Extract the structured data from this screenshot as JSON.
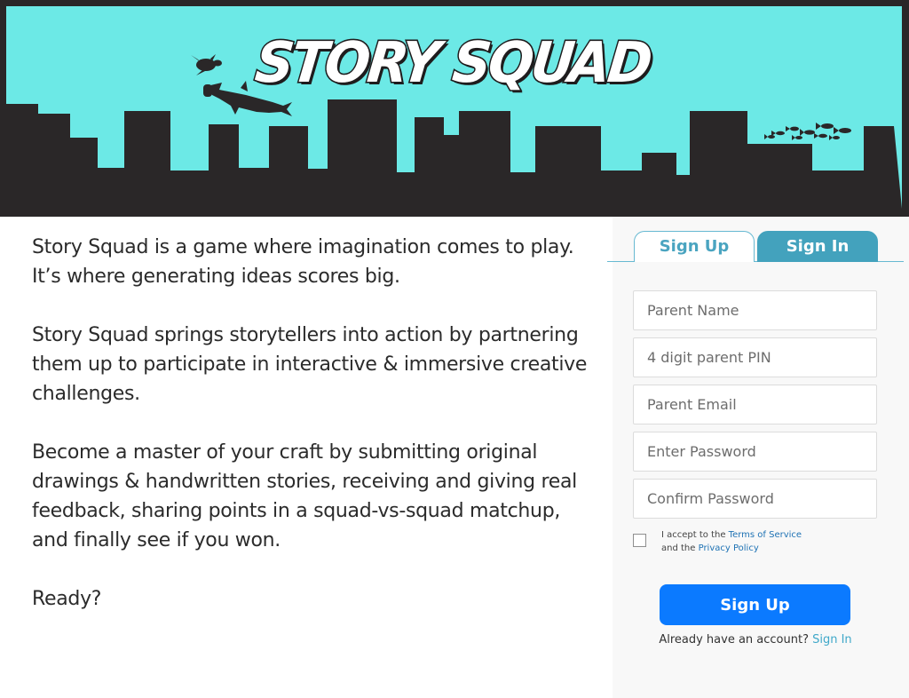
{
  "header": {
    "logo_text": "STORY SQUAD",
    "sky_color": "#6ce9e6",
    "silhouette_color": "#2a2728",
    "decorations": [
      "sea-turtle-icon",
      "hammerhead-shark-icon",
      "fish-school-icon",
      "city-skyline"
    ]
  },
  "intro": {
    "paragraphs": [
      "Story Squad is a game where imagination comes to play. It’s where generating ideas scores big.",
      "Story Squad springs storytellers into action by partnering them up to participate in interactive & immersive creative challenges.",
      "Become a master of your craft by submitting original drawings & handwritten stories, receiving and giving real feedback, sharing points in a squad-vs-squad matchup, and finally see if you won.",
      "Ready?"
    ]
  },
  "auth": {
    "tabs": [
      {
        "label": "Sign Up",
        "active": true
      },
      {
        "label": "Sign In",
        "active": false
      }
    ],
    "fields": {
      "parent_name": {
        "placeholder": "Parent Name",
        "value": ""
      },
      "parent_pin": {
        "placeholder": "4 digit parent PIN",
        "value": ""
      },
      "parent_email": {
        "placeholder": "Parent Email",
        "value": ""
      },
      "password": {
        "placeholder": "Enter Password",
        "value": ""
      },
      "confirm_password": {
        "placeholder": "Confirm Password",
        "value": ""
      }
    },
    "terms": {
      "prefix": "I accept to the ",
      "terms_link": "Terms of Service",
      "middle": "and the ",
      "privacy_link": "Privacy Policy",
      "checked": false
    },
    "submit_label": "Sign Up",
    "footer": {
      "prompt": "Already have an account? ",
      "link": "Sign In"
    },
    "colors": {
      "accent": "#43a2bd",
      "button": "#0b7aff",
      "link": "#1e72b4"
    }
  }
}
